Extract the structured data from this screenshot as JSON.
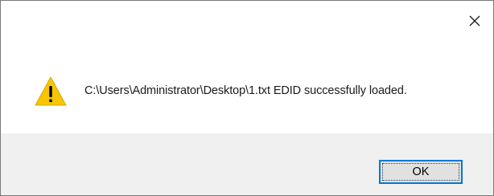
{
  "dialog": {
    "close_glyph": "×",
    "message": "C:\\Users\\Administrator\\Desktop\\1.txt EDID successfully loaded.",
    "icon": "warning-icon",
    "ok_label": "OK"
  },
  "colors": {
    "warning_fill": "#f7c600",
    "warning_mark": "#000000",
    "ok_border": "#0078d7",
    "footer_bg": "#f0f0f0"
  }
}
